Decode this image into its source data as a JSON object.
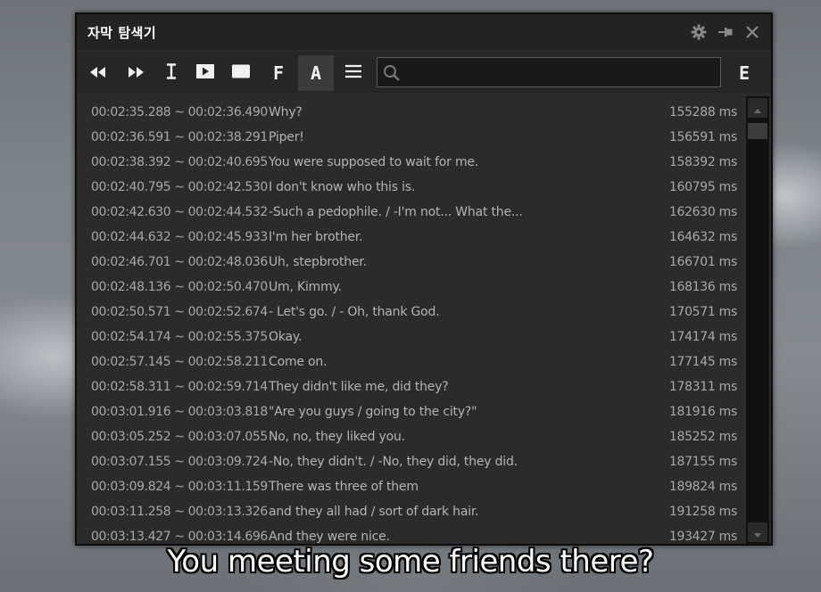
{
  "window": {
    "title": "자막 탐색기",
    "title_icons": [
      "gear-icon",
      "pin-icon",
      "close-icon"
    ]
  },
  "toolbar": {
    "buttons": [
      {
        "name": "rewind-button",
        "icon": "rewind-icon"
      },
      {
        "name": "fast-forward-button",
        "icon": "fast-forward-icon"
      },
      {
        "name": "text-cursor-button",
        "icon": "text-cursor-icon"
      },
      {
        "name": "play-box-button",
        "icon": "play-box-icon"
      },
      {
        "name": "subtitle-box-button",
        "icon": "blank-box-icon"
      },
      {
        "name": "f-button",
        "label": "F"
      },
      {
        "name": "a-button",
        "label": "A",
        "active": true
      },
      {
        "name": "menu-button",
        "icon": "hamburger-icon"
      }
    ],
    "search": {
      "value": "",
      "placeholder": "",
      "icon": "search-icon"
    },
    "e_label": "E"
  },
  "list": {
    "rows": [
      {
        "time": "00:02:35.288 ~ 00:02:36.490",
        "text": "Why?",
        "ms": "155288 ms"
      },
      {
        "time": "00:02:36.591 ~ 00:02:38.291",
        "text": "Piper!",
        "ms": "156591 ms"
      },
      {
        "time": "00:02:38.392 ~ 00:02:40.695",
        "text": "You were supposed to wait for me.",
        "ms": "158392 ms"
      },
      {
        "time": "00:02:40.795 ~ 00:02:42.530",
        "text": "I don't know who this is.",
        "ms": "160795 ms"
      },
      {
        "time": "00:02:42.630 ~ 00:02:44.532",
        "text": "-Such a pedophile. / -I'm not... What the...",
        "ms": "162630 ms"
      },
      {
        "time": "00:02:44.632 ~ 00:02:45.933",
        "text": "I'm her brother.",
        "ms": "164632 ms"
      },
      {
        "time": "00:02:46.701 ~ 00:02:48.036",
        "text": "Uh, stepbrother.",
        "ms": "166701 ms"
      },
      {
        "time": "00:02:48.136 ~ 00:02:50.470",
        "text": "Um, Kimmy.",
        "ms": "168136 ms"
      },
      {
        "time": "00:02:50.571 ~ 00:02:52.674",
        "text": "- Let's go. / - Oh, thank God.",
        "ms": "170571 ms"
      },
      {
        "time": "00:02:54.174 ~ 00:02:55.375",
        "text": "Okay.",
        "ms": "174174 ms"
      },
      {
        "time": "00:02:57.145 ~ 00:02:58.211",
        "text": "Come on.",
        "ms": "177145 ms"
      },
      {
        "time": "00:02:58.311 ~ 00:02:59.714",
        "text": "They didn't like me, did they?",
        "ms": "178311 ms"
      },
      {
        "time": "00:03:01.916 ~ 00:03:03.818",
        "text": "\"Are you guys / going to the city?\"",
        "ms": "181916 ms"
      },
      {
        "time": "00:03:05.252 ~ 00:03:07.055",
        "text": "No, no, they liked you.",
        "ms": "185252 ms"
      },
      {
        "time": "00:03:07.155 ~ 00:03:09.724",
        "text": "-No, they didn't. / -No, they did, they did.",
        "ms": "187155 ms"
      },
      {
        "time": "00:03:09.824 ~ 00:03:11.159",
        "text": "There was three of them",
        "ms": "189824 ms"
      },
      {
        "time": "00:03:11.258 ~ 00:03:13.326",
        "text": "and they all had / sort of dark hair.",
        "ms": "191258 ms"
      },
      {
        "time": "00:03:13.427 ~ 00:03:14.696",
        "text": "And they were nice.",
        "ms": "193427 ms"
      }
    ]
  },
  "scrollbar": {
    "up_icon": "triangle-up-icon",
    "down_icon": "triangle-down-icon"
  },
  "video": {
    "subtitle": "You meeting some friends there?"
  }
}
